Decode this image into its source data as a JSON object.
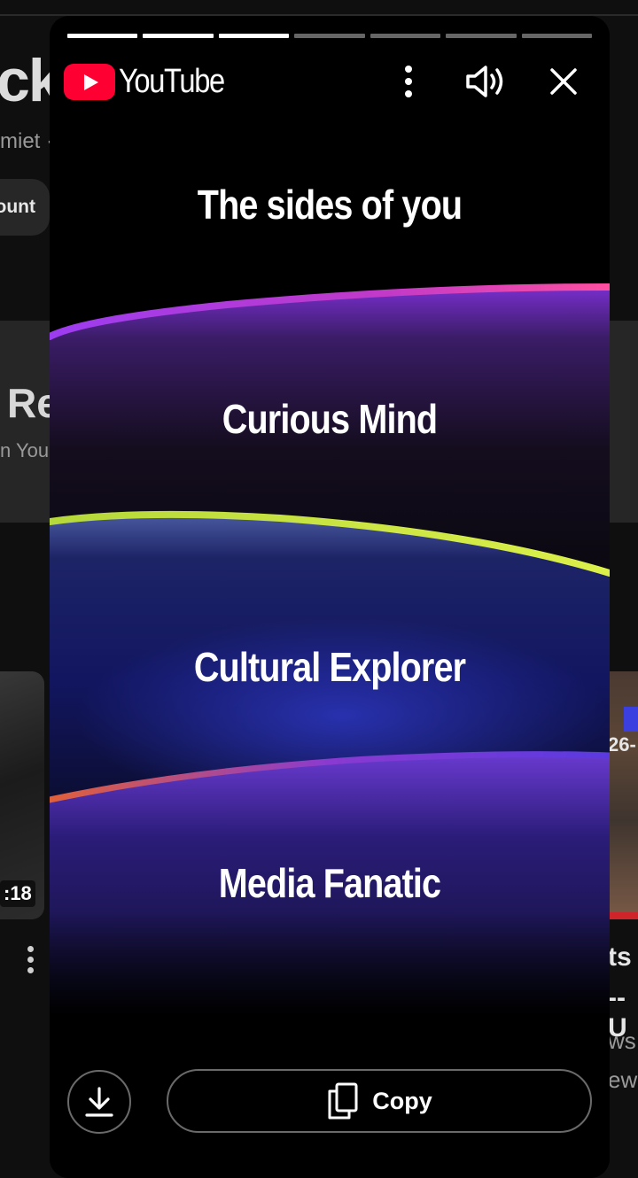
{
  "background": {
    "title_fragment": "ck",
    "subtitle_fragment": "miet ·",
    "chip_fragment": "ount",
    "band_title_fragment": "Re",
    "band_sub_fragment": "n You",
    "duration_fragment": ":18",
    "right_badge_fragment": "26-",
    "right_line1": "ts",
    "right_line2": "--U",
    "right_line3": "ws",
    "right_line4": "ew"
  },
  "modal": {
    "brand": "YouTube",
    "progress": {
      "total_segments": 7,
      "completed_segments": 3
    },
    "headline": "The sides of you",
    "traits": [
      {
        "label": "Curious Mind",
        "glow_color": "#d63bb0"
      },
      {
        "label": "Cultural Explorer",
        "glow_color": "#c9e83a"
      },
      {
        "label": "Media Fanatic",
        "glow_color": "#e0603a"
      }
    ],
    "actions": {
      "download_icon": "download-icon",
      "copy_label": "Copy",
      "copy_icon": "copy-icon"
    },
    "icons": {
      "more": "more-vertical-icon",
      "sound": "volume-icon",
      "close": "close-icon"
    }
  }
}
